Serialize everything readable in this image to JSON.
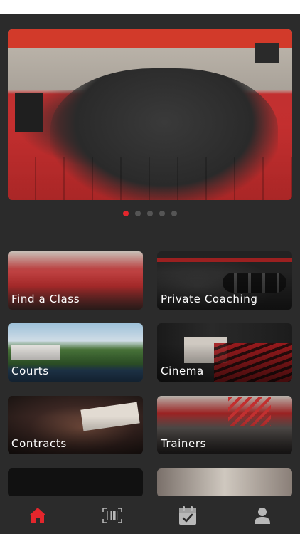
{
  "hero": {
    "slide_count": 5,
    "active_slide": 1
  },
  "tiles": [
    {
      "id": "find-a-class",
      "label": "Find a Class"
    },
    {
      "id": "private-coaching",
      "label": "Private Coaching"
    },
    {
      "id": "courts",
      "label": "Courts"
    },
    {
      "id": "cinema",
      "label": "Cinema"
    },
    {
      "id": "contracts",
      "label": "Contracts"
    },
    {
      "id": "trainers",
      "label": "Trainers"
    }
  ],
  "nav": {
    "items": [
      {
        "icon": "home-icon",
        "active": true
      },
      {
        "icon": "barcode-icon",
        "active": false
      },
      {
        "icon": "calendar-check-icon",
        "active": false
      },
      {
        "icon": "profile-icon",
        "active": false
      }
    ],
    "active_color": "#e3262c",
    "inactive_color": "#b8b8b8"
  },
  "colors": {
    "background": "#2b2b2b",
    "accent": "#e3262c"
  }
}
